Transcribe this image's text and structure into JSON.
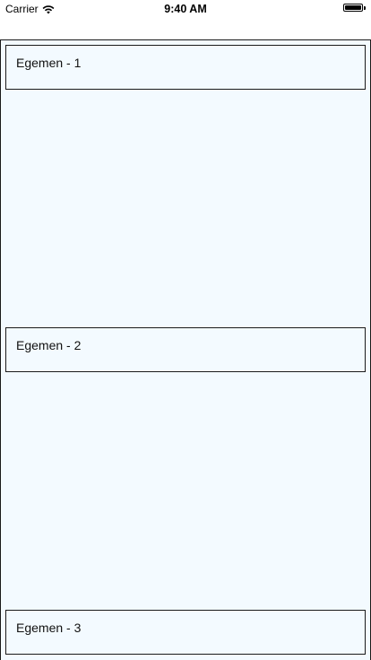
{
  "status_bar": {
    "carrier": "Carrier",
    "time": "9:40 AM",
    "wifi_icon": "wifi-icon",
    "battery_icon": "battery-icon",
    "battery_level": 1.0
  },
  "colors": {
    "content_background": "#f3faff",
    "border": "#1a1a1a"
  },
  "segments": [
    {
      "label": "Egemen - 1"
    },
    {
      "label": "Egemen - 2"
    },
    {
      "label": "Egemen - 3"
    }
  ]
}
